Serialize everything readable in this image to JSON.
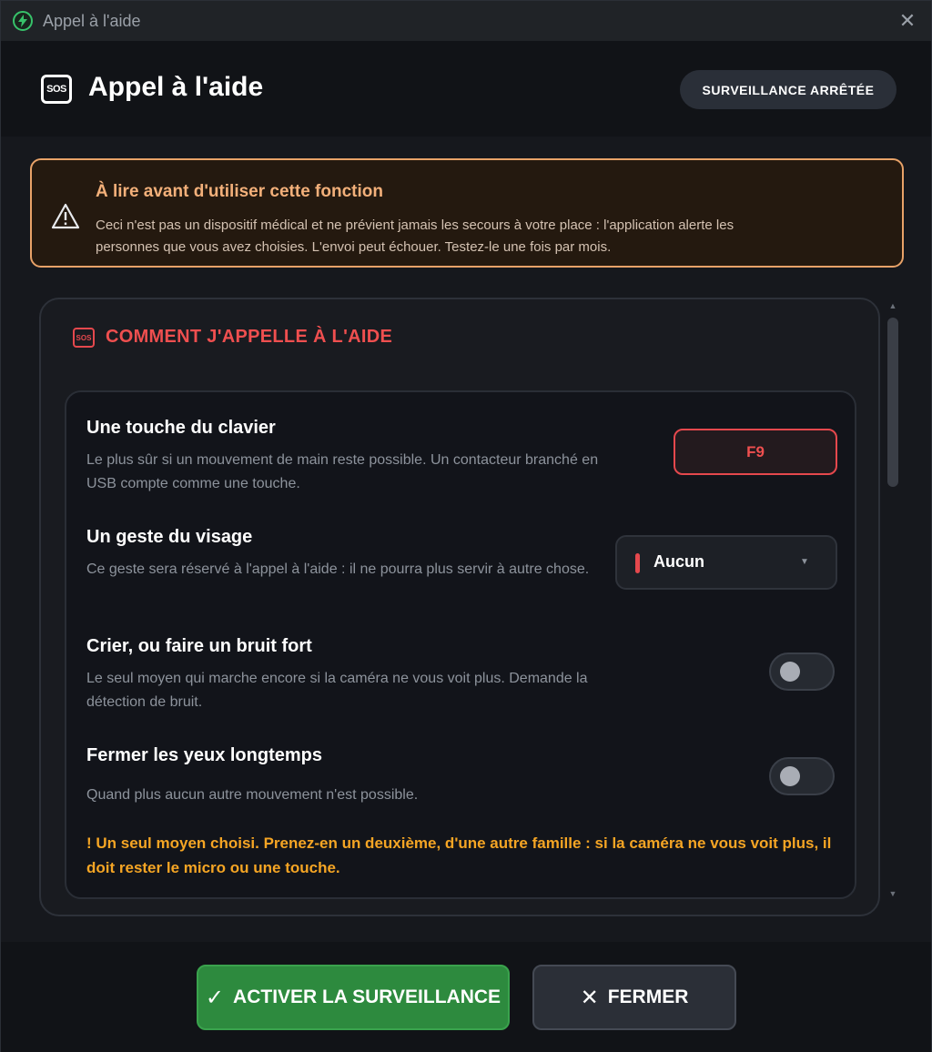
{
  "window": {
    "title": "Appel à l'aide",
    "app_icon": "lightning-icon",
    "close_icon": "close-icon"
  },
  "header": {
    "title": "Appel à l'aide",
    "icon": "sos-icon",
    "status": "SURVEILLANCE ARRÊTÉE"
  },
  "warning": {
    "icon": "warning-icon",
    "title": "À lire avant d'utiliser cette fonction",
    "body": "Ceci n'est pas un dispositif médical et ne prévient jamais les secours à votre place : l'application alerte les personnes que vous avez choisies. L'envoi peut échouer. Testez-le une fois par mois."
  },
  "card": {
    "icon": "sos-icon",
    "title": "COMMENT J'APPELLE À L'AIDE",
    "options": {
      "keyboard": {
        "title": "Une touche du clavier",
        "desc": "Le plus sûr si un mouvement de main reste possible. Un contacteur branché en USB compte comme une touche.",
        "key": "F9"
      },
      "face": {
        "title": "Un geste du visage",
        "desc": "Ce geste sera réservé à l'appel à l'aide : il ne pourra plus servir à autre chose.",
        "selected": "Aucun"
      },
      "shout": {
        "title": "Crier, ou faire un bruit fort",
        "desc": "Le seul moyen qui marche encore si la caméra ne vous voit plus. Demande la détection de bruit.",
        "enabled": false
      },
      "eyes": {
        "title": "Fermer les yeux longtemps",
        "desc": "Quand plus aucun autre mouvement n'est possible.",
        "enabled": false
      }
    },
    "notice": "! Un seul moyen choisi. Prenez-en un deuxième, d'une autre famille : si la caméra ne vous voit plus, il doit rester le micro ou une touche."
  },
  "footer": {
    "activate_icon": "✓",
    "activate_label": "ACTIVER LA SURVEILLANCE",
    "close_icon": "✕",
    "close_label": "FERMER"
  },
  "colors": {
    "accent_red": "#e5484d",
    "warning_orange": "#e8a268",
    "notice_amber": "#f5a524",
    "activate_green": "#2d8a3e"
  }
}
